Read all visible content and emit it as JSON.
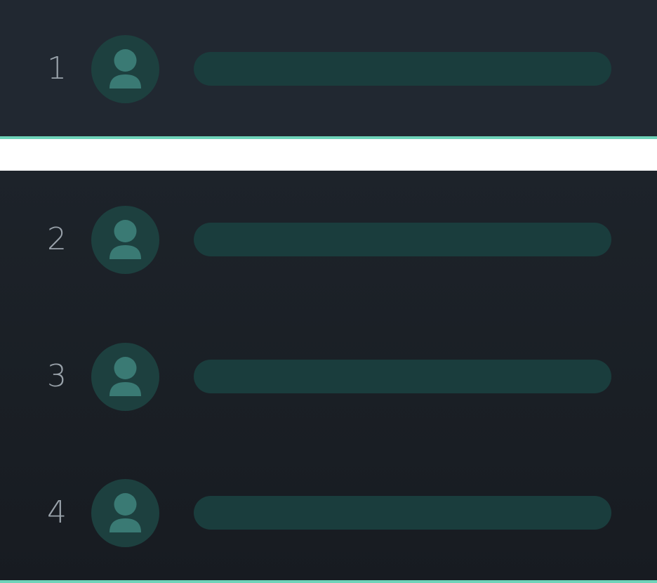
{
  "leaderboard": {
    "pinned_row": {
      "rank": "1",
      "avatar_icon": "person-icon"
    },
    "rows": [
      {
        "rank": "2",
        "avatar_icon": "person-icon"
      },
      {
        "rank": "3",
        "avatar_icon": "person-icon"
      },
      {
        "rank": "4",
        "avatar_icon": "person-icon"
      }
    ]
  },
  "colors": {
    "accent": "#6ed3b9",
    "pinned_background": "#212831",
    "list_background": "#1a1f25",
    "avatar_circle": "#1d403f",
    "avatar_figure": "#3a7a74",
    "placeholder_bar": "#1a3d3d",
    "rank_text": "#9aa3ab"
  }
}
